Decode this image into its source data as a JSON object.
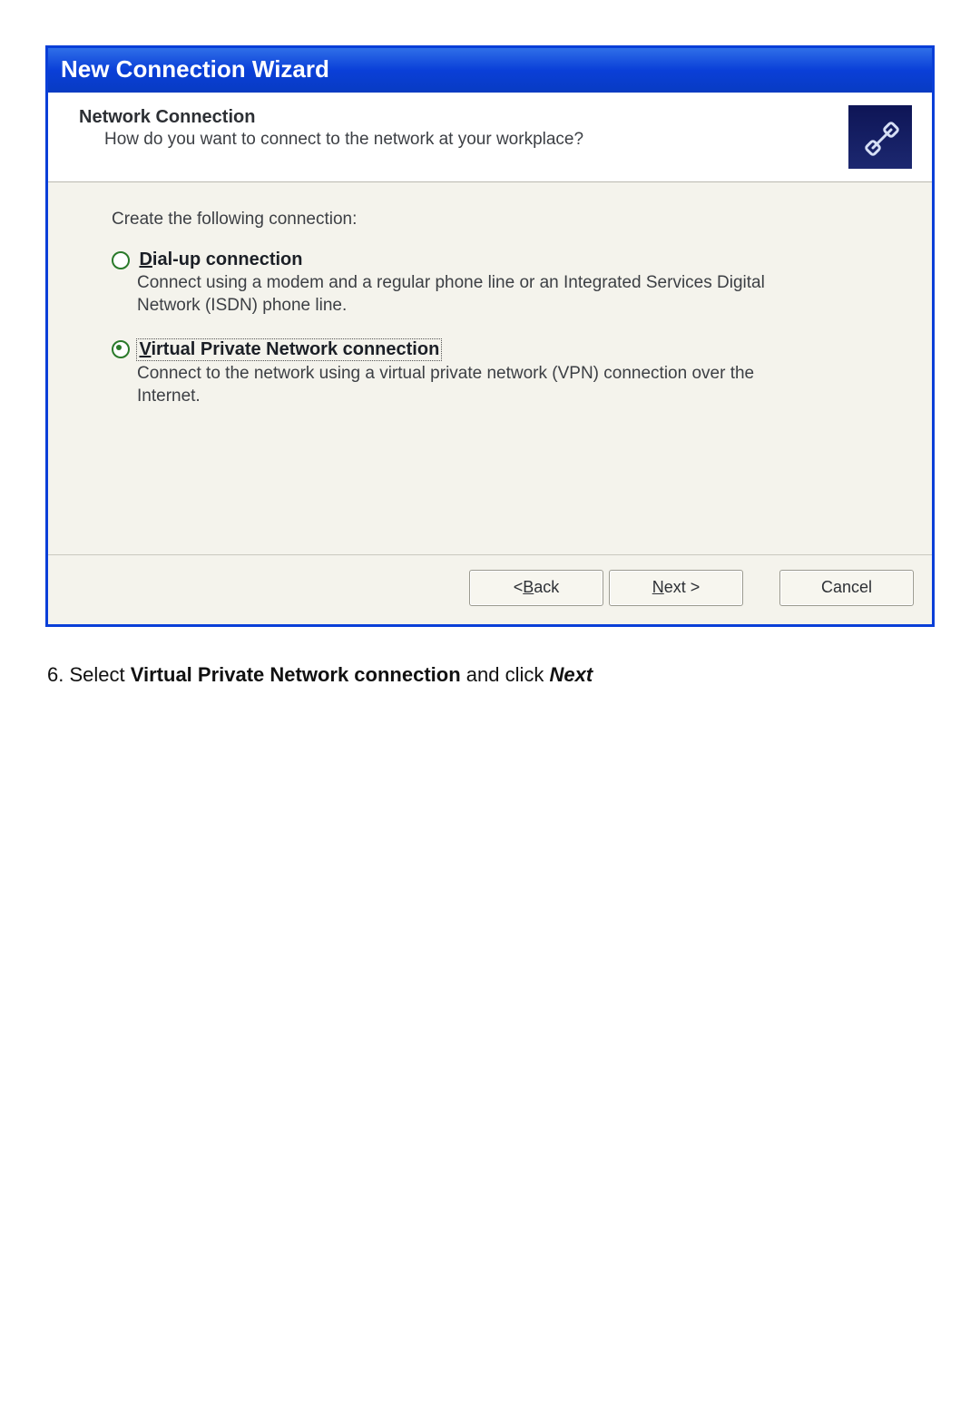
{
  "wizard": {
    "title": "New Connection Wizard",
    "header_title": "Network Connection",
    "header_sub": "How do you want to connect to the network at your workplace?",
    "prompt": "Create the following connection:",
    "options": [
      {
        "label_pre": "",
        "label_access": "D",
        "label_post": "ial-up connection",
        "desc": "Connect using a modem and a regular phone line or an Integrated Services Digital Network (ISDN) phone line."
      },
      {
        "label_pre": "",
        "label_access": "V",
        "label_post": "irtual Private Network connection",
        "desc": "Connect to the network using a virtual private network (VPN) connection over the Internet."
      }
    ],
    "buttons": {
      "back_pre": "< ",
      "back_access": "B",
      "back_post": "ack",
      "next_pre": "",
      "next_access": "N",
      "next_post": "ext >",
      "cancel": "Cancel"
    }
  },
  "instruction": {
    "step": "6.",
    "pre": " Select ",
    "bold1": "Virtual Private Network connection",
    "mid": " and click ",
    "bold2": "Next"
  }
}
